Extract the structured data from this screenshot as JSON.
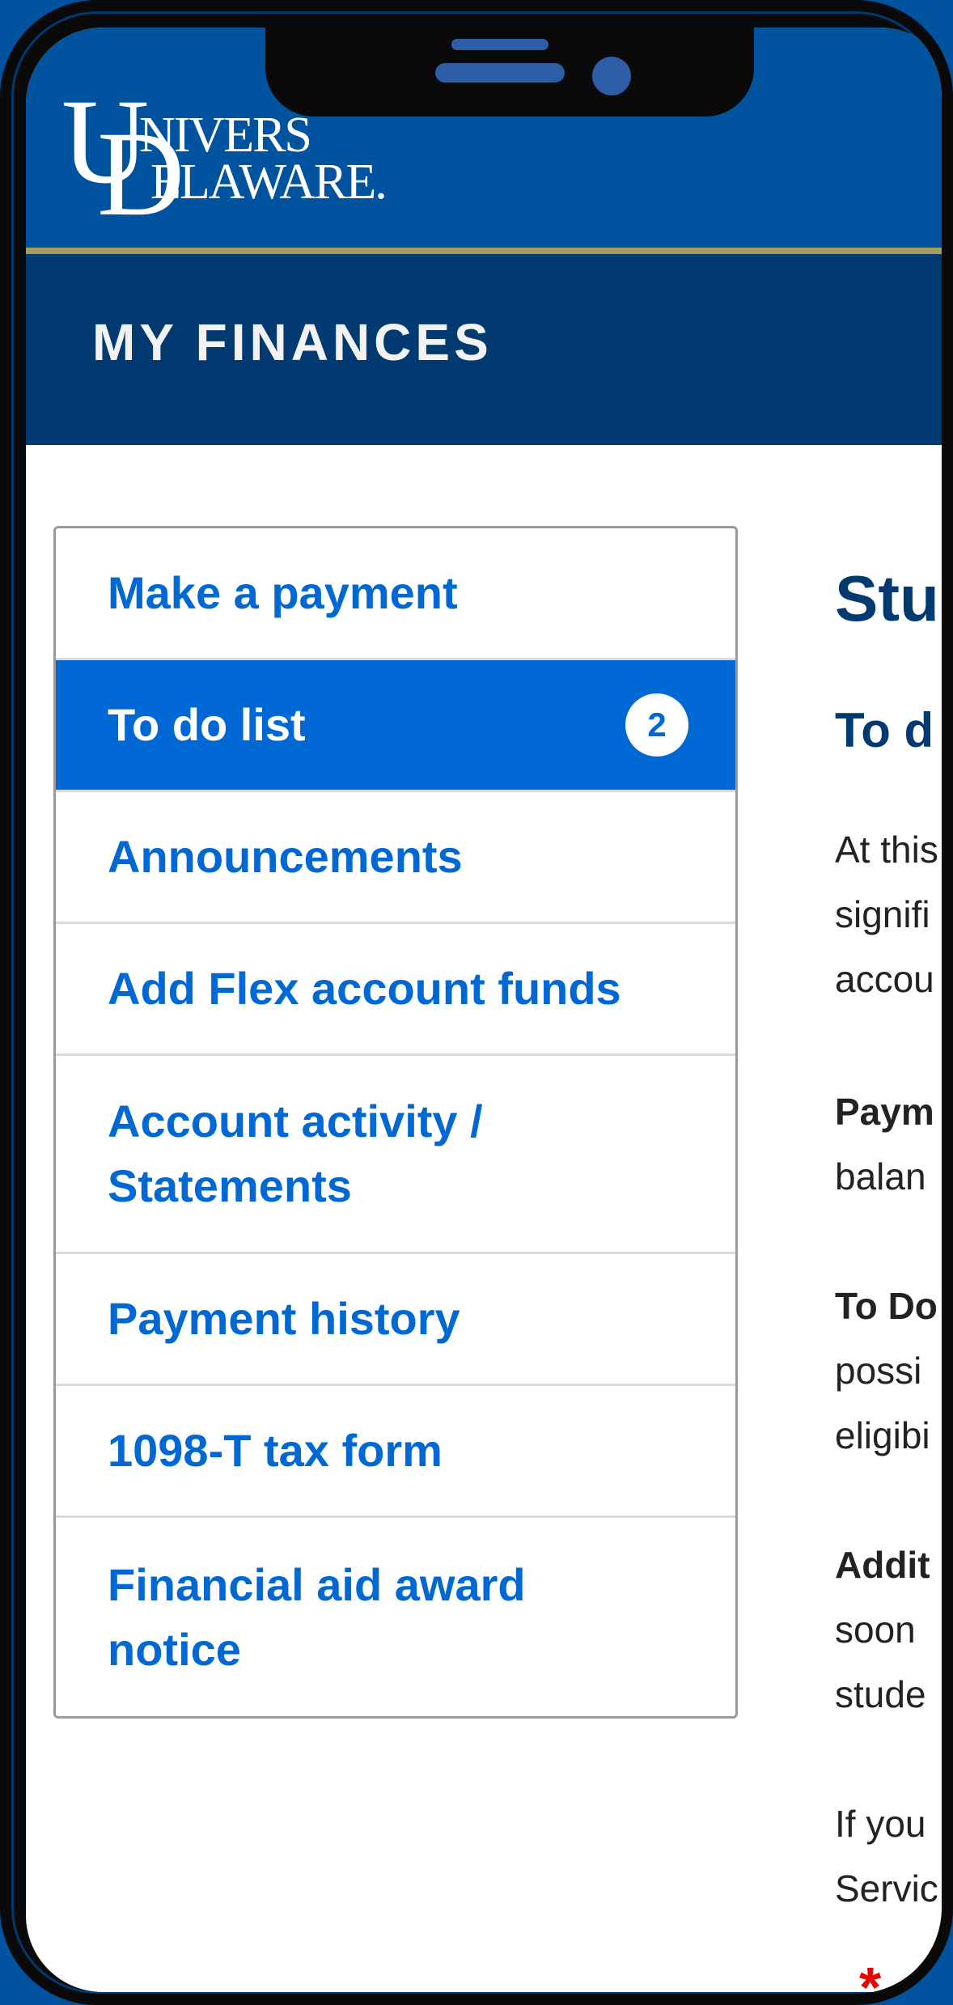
{
  "header": {
    "logo_line1": "NIVERS",
    "logo_line2": "ELAWARE.",
    "logo_u": "U",
    "logo_d": "D",
    "section_title": "MY FINANCES"
  },
  "menu": {
    "items": [
      {
        "label": "Make a payment"
      },
      {
        "label": "To do list",
        "badge": "2",
        "active": true
      },
      {
        "label": "Announcements"
      },
      {
        "label": "Add Flex account funds"
      },
      {
        "label_line1": "Account activity /",
        "label_line2": "Statements"
      },
      {
        "label": "Payment history"
      },
      {
        "label": "1098-T tax form"
      },
      {
        "label_line1": "Financial aid award",
        "label_line2": "notice"
      }
    ]
  },
  "content": {
    "heading": "Stu",
    "subheading": "To d",
    "lines": [
      "At this",
      "signifi",
      "accou",
      "Paym",
      "balan",
      "To Do",
      "possi",
      "eligibi",
      "Addit",
      "soon",
      "stude",
      "If you",
      "Servic"
    ],
    "asterisk": "*"
  }
}
